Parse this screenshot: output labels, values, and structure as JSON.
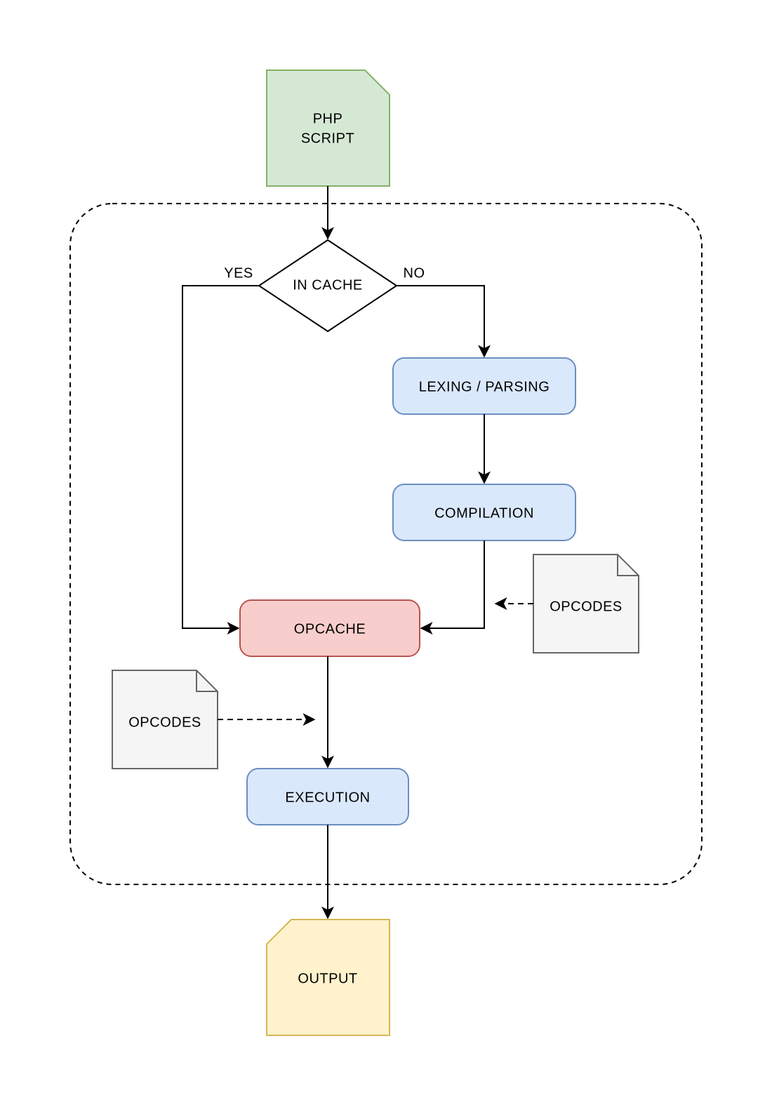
{
  "nodes": {
    "php_script": {
      "line1": "PHP",
      "line2": "SCRIPT"
    },
    "in_cache": {
      "label": "IN CACHE"
    },
    "lexing": {
      "label": "LEXING / PARSING"
    },
    "compilation": {
      "label": "COMPILATION"
    },
    "opcache": {
      "label": "OPCACHE"
    },
    "execution": {
      "label": "EXECUTION"
    },
    "output": {
      "label": "OUTPUT"
    },
    "opcodes_right": {
      "label": "OPCODES"
    },
    "opcodes_left": {
      "label": "OPCODES"
    }
  },
  "edges": {
    "yes": "YES",
    "no": "NO"
  },
  "colors": {
    "green_fill": "#d5e8d4",
    "green_stroke": "#82b366",
    "blue_fill": "#dae8fc",
    "blue_stroke": "#6c8ebf",
    "red_fill": "#f8cecc",
    "red_stroke": "#b85450",
    "yellow_fill": "#fff2cc",
    "yellow_stroke": "#d6b656",
    "grey_fill": "#f5f5f5",
    "grey_stroke": "#666666",
    "black": "#000000"
  }
}
